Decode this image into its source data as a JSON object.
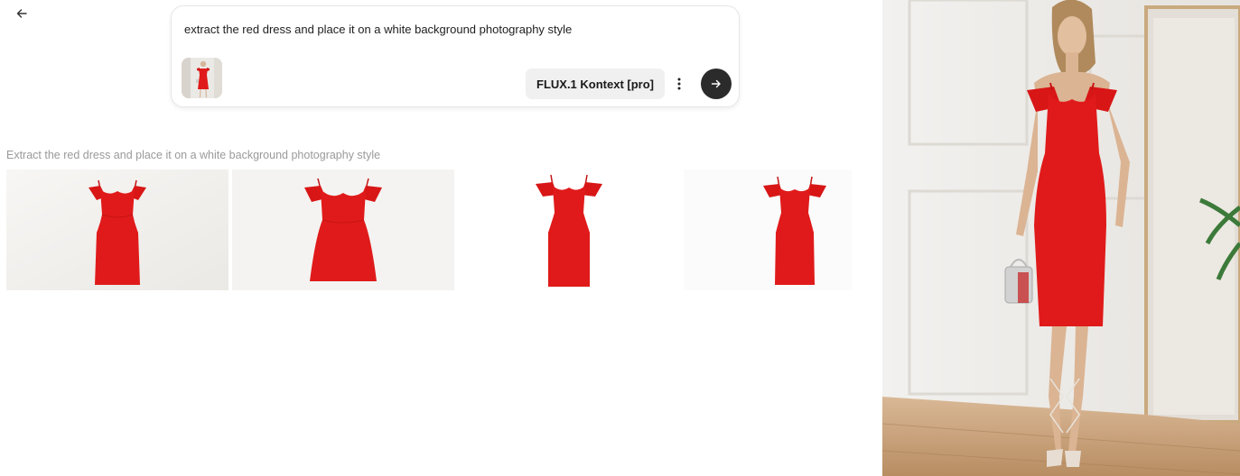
{
  "header": {
    "back_icon": "arrow-left-icon"
  },
  "prompt": {
    "text": "extract the red dress and place it on a white background photography style",
    "model_label": "FLUX.1 Kontext [pro]",
    "more_icon": "vertical-dots-icon",
    "send_icon": "arrow-right-icon"
  },
  "results": {
    "caption": "Extract the red dress and place it on a white background photography style",
    "count": 4
  },
  "colors": {
    "dress_red": "#e01a1a",
    "send_button": "#2b2b2b",
    "model_button_bg": "#f0f0f0"
  }
}
